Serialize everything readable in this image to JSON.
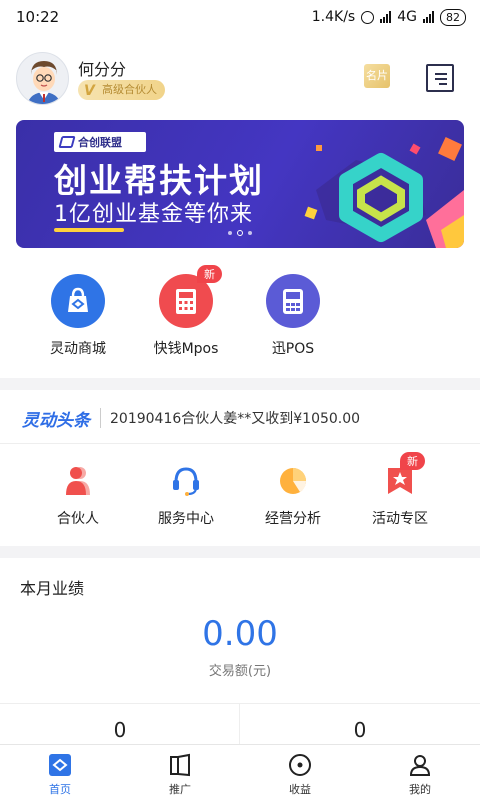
{
  "status_bar": {
    "time": "10:22",
    "net_speed": "1.4K/s",
    "network": "4G",
    "battery": "82"
  },
  "profile": {
    "name": "何分分",
    "level": "高级合伙人",
    "level_mark": "V",
    "card_label": "名片"
  },
  "banner": {
    "logo_text": "合创联盟",
    "title": "创业帮扶计划",
    "subtitle": "1亿创业基金等你来"
  },
  "apps": [
    {
      "label": "灵动商城",
      "badge": ""
    },
    {
      "label": "快钱Mpos",
      "badge": "新"
    },
    {
      "label": "迅POS",
      "badge": ""
    }
  ],
  "news": {
    "logo": "灵动头条",
    "text": "20190416合伙人姜**又收到¥1050.00"
  },
  "services": [
    {
      "label": "合伙人",
      "badge": ""
    },
    {
      "label": "服务中心",
      "badge": ""
    },
    {
      "label": "经营分析",
      "badge": ""
    },
    {
      "label": "活动专区",
      "badge": "新"
    }
  ],
  "performance": {
    "title": "本月业绩",
    "amount": "0.00",
    "amount_label": "交易额(元)",
    "left_value": "0",
    "right_value": "0"
  },
  "tabbar": [
    {
      "label": "首页",
      "icon": "home-icon",
      "active": true
    },
    {
      "label": "推广",
      "icon": "promote-icon",
      "active": false
    },
    {
      "label": "收益",
      "icon": "income-icon",
      "active": false
    },
    {
      "label": "我的",
      "icon": "user-icon",
      "active": false
    }
  ],
  "colors": {
    "accent": "#2f74e6",
    "badge_red": "#f0444a",
    "banner_bg": "#4436c2",
    "mall_blue": "#2f74e6",
    "mpos_red": "#f04b4f",
    "pos_purple": "#5b5bd6"
  }
}
